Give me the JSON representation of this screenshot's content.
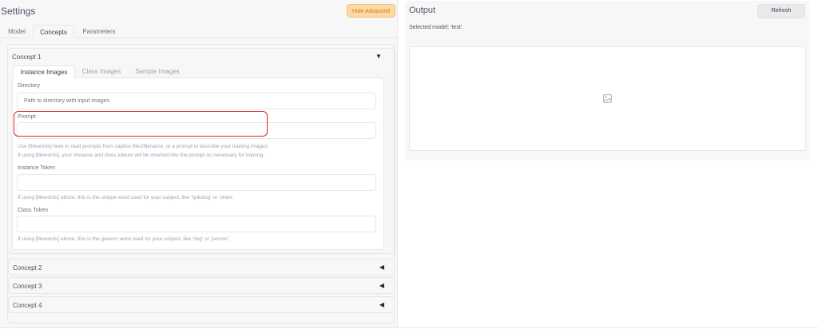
{
  "settings": {
    "title": "Settings",
    "hide_advanced_label": "Hide Advanced",
    "tabs": [
      {
        "label": "Model",
        "active": false
      },
      {
        "label": "Concepts",
        "active": true
      },
      {
        "label": "Parameters",
        "active": false
      }
    ]
  },
  "concepts": {
    "concept1": {
      "label": "Concept 1",
      "expanded": true,
      "subtabs": [
        {
          "label": "Instance Images",
          "active": true
        },
        {
          "label": "Class Images",
          "active": false
        },
        {
          "label": "Sample Images",
          "active": false
        }
      ],
      "directory": {
        "label": "Directory",
        "placeholder": "Path to directory with input images",
        "value": ""
      },
      "prompt": {
        "label": "Prompt",
        "value": "",
        "hint1": "Use [filewords] here to read prompts from caption files/filename, or a prompt to describe your training images.",
        "hint2": "If using [filewords], your instance and class tokens will be inserted into the prompt as necessary for training."
      },
      "instance_token": {
        "label": "Instance Token",
        "value": "",
        "hint": "If using [filewords] above, this is the unique word used for your subject, like 'fydodog' or 'ohwx'."
      },
      "class_token": {
        "label": "Class Token",
        "value": "",
        "hint": "If using [filewords] above, this is the generic word used for your subject, like 'dog' or 'person'."
      }
    },
    "concept2": {
      "label": "Concept 2"
    },
    "concept3": {
      "label": "Concept 3"
    },
    "concept4": {
      "label": "Concept 4"
    }
  },
  "output": {
    "title": "Output",
    "refresh_label": "Refresh",
    "selected_model": "Selected model: 'test'."
  },
  "icons": {
    "collapse": "triangle-down-icon",
    "expand": "triangle-left-icon",
    "image_placeholder": "image-icon"
  },
  "colors": {
    "accent": "#f8bf7a",
    "highlight": "#dc2626",
    "panel_bg": "#f7f7f8"
  }
}
